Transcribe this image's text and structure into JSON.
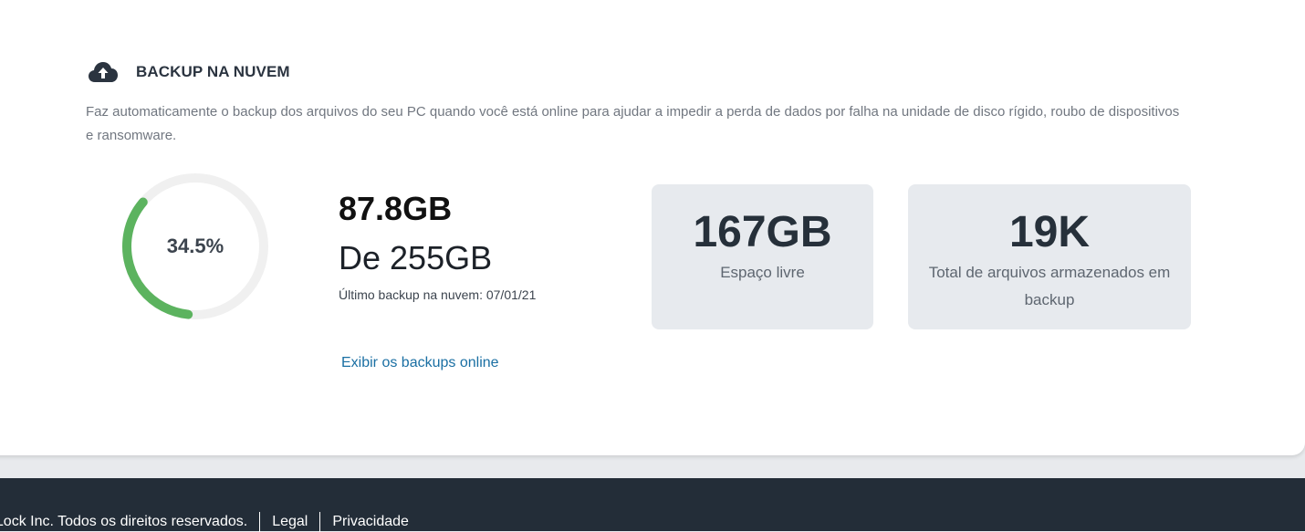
{
  "section": {
    "title": "BACKUP NA NUVEM",
    "icon": "cloud-upload-icon",
    "description": "Faz automaticamente o backup dos arquivos do seu PC quando você está online para ajudar a impedir a perda de dados por falha na unidade de disco rígido, roubo de dispositivos e ransomware."
  },
  "usage": {
    "percent_label": "34.5%",
    "percent_value": 0.345,
    "used": "87.8GB",
    "total": "De 255GB",
    "last_backup": "Último backup na nuvem: 07/01/21",
    "view_link": "Exibir os backups online"
  },
  "stats": {
    "free_value": "167GB",
    "free_label": "Espaço livre",
    "files_value": "19K",
    "files_label": "Total de arquivos armazenados em backup"
  },
  "footer": {
    "copyright": "eLock Inc. Todos os direitos reservados.",
    "legal": "Legal",
    "privacy": "Privacidade"
  },
  "colors": {
    "gauge_fill": "#5cb35f",
    "gauge_track": "#f0f0f0",
    "link": "#1a6fa3",
    "footer_bg": "#232d38",
    "stat_box_bg": "#e7eaee"
  }
}
